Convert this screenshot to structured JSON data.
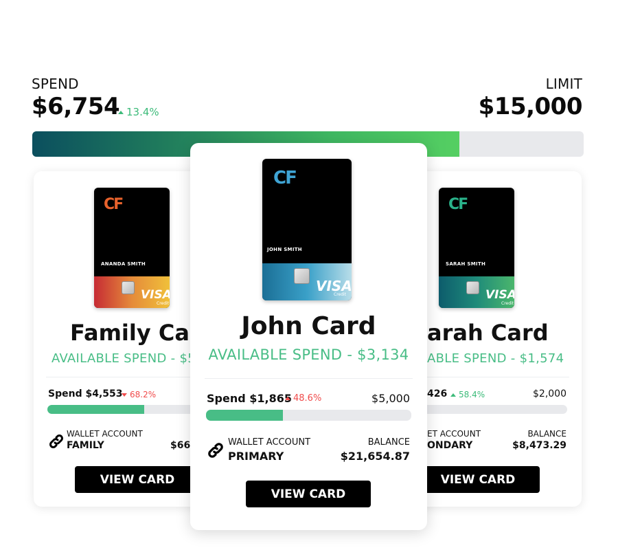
{
  "header": {
    "spend_label": "SPEND",
    "spend_amount": "$6,754",
    "spend_delta": "13.4%",
    "limit_label": "LIMIT",
    "limit_amount": "$15,000",
    "progress_fraction": 0.7746
  },
  "cards": {
    "family": {
      "holder": "ANANDA SMITH",
      "name": "Family Card",
      "available": "AVAILABLE SPEND  -  $5",
      "spend": "Spend $4,553",
      "delta": "68.2%",
      "delta_direction": "down",
      "limit": "",
      "progress_fraction": 0.47,
      "wallet_label": "WALLET ACCOUNT",
      "wallet_type": "FAMILY",
      "balance_label": "",
      "balance": "$66,",
      "button": "VIEW CARD",
      "stripe_colors": [
        "#c62b34",
        "#e58b3a",
        "#f0c03a"
      ]
    },
    "john": {
      "holder": "JOHN SMITH",
      "name": "John Card",
      "available": "AVAILABLE SPEND  -  $3,134",
      "spend": "Spend $1,865",
      "delta": "48.6%",
      "delta_direction": "up",
      "limit": "$5,000",
      "progress_fraction": 0.373,
      "wallet_label": "WALLET ACCOUNT",
      "wallet_type": "PRIMARY",
      "balance_label": "BALANCE",
      "balance": "$21,654.87",
      "button": "VIEW CARD",
      "stripe_colors": [
        "#1b6f96",
        "#3aa0c8",
        "#b8dde9"
      ]
    },
    "sarah": {
      "holder": "SARAH SMITH",
      "name": "arah Card",
      "available": "ABLE SPEND  -  $1,574",
      "spend": "426",
      "delta": "58.4%",
      "delta_direction": "up",
      "limit": "$2,000",
      "progress_fraction": 0.21,
      "wallet_label": "ET ACCOUNT",
      "wallet_type": "ONDARY",
      "balance_label": "BALANCE",
      "balance": "$8,473.29",
      "button": "VIEW CARD",
      "stripe_colors": [
        "#0d5c6c",
        "#1f8b7a",
        "#4bb66c"
      ]
    }
  },
  "colors": {
    "accent_green": "#48bd86",
    "delta_up": "#3dbb7a",
    "delta_down": "#f04b4b"
  },
  "icons": {
    "link": "link-icon",
    "triangle_up": "triangle-up-icon",
    "triangle_down": "triangle-down-icon"
  }
}
